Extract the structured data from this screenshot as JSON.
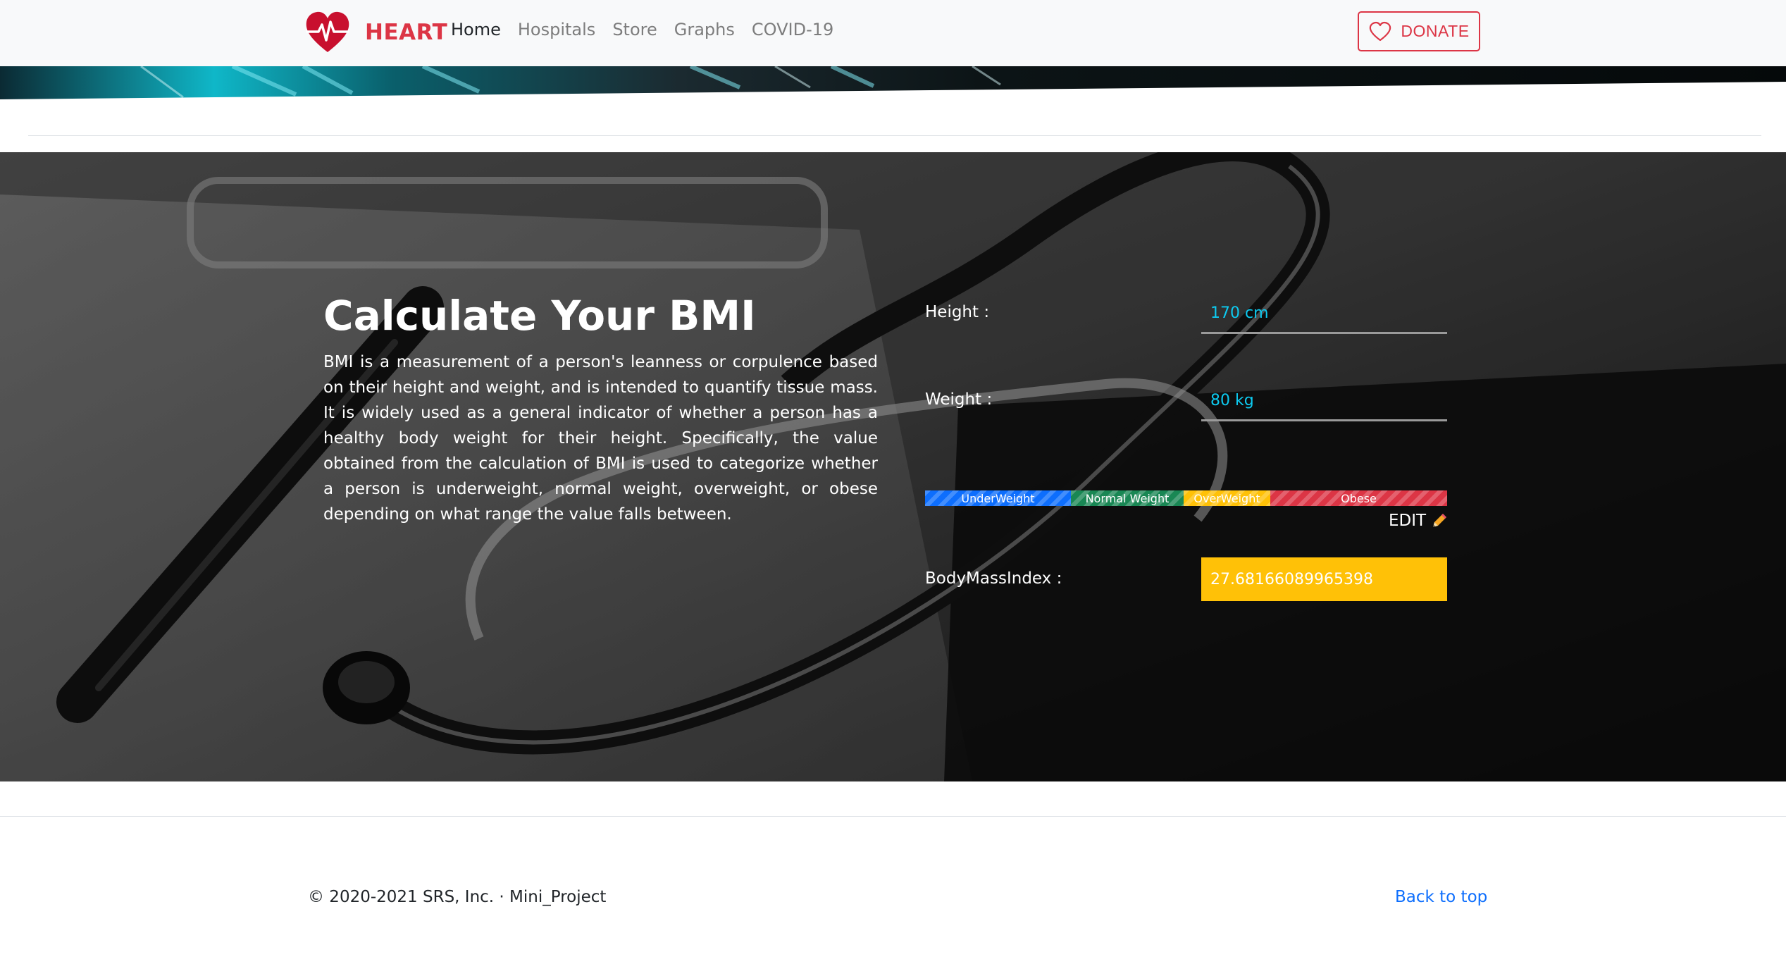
{
  "navbar": {
    "brand": "HEART",
    "brand_icon": "heart-pulse-icon",
    "links": [
      {
        "label": "Home",
        "active": true
      },
      {
        "label": "Hospitals",
        "active": false
      },
      {
        "label": "Store",
        "active": false
      },
      {
        "label": "Graphs",
        "active": false
      },
      {
        "label": "COVID-19",
        "active": false
      }
    ],
    "donate_label": "DONATE",
    "donate_icon": "heart-outline-icon"
  },
  "hero": {
    "title": "Calculate Your BMI",
    "description": "BMI is a measurement of a person's leanness or corpulence based on their height and weight, and is intended to quantify tissue mass. It is widely used as a general indicator of whether a person has a healthy body weight for their height. Specifically, the value obtained from the calculation of BMI is used to categorize whether a person is underweight, normal weight, overweight, or obese depending on what range the value falls between.",
    "height_label": "Height :",
    "height_value": "170 cm",
    "weight_label": "Weight :",
    "weight_value": "80 kg",
    "scale": {
      "underweight": "UnderWeight",
      "normal": "Normal Weight",
      "overweight": "OverWeight",
      "obese": "Obese"
    },
    "edit_label": "EDIT",
    "edit_icon": "pencil-icon",
    "bmi_label": "BodyMassIndex :",
    "bmi_value": "27.68166089965398"
  },
  "footer": {
    "copyright": "© 2020-2021 SRS, Inc. · Mini_Project",
    "back_to_top": "Back to top"
  },
  "colors": {
    "brand_red": "#dc3545",
    "accent_cyan": "#0dcaf0",
    "result_yellow": "#ffc107",
    "link_blue": "#0d6efd",
    "scale_underweight": "#0d6efd",
    "scale_normal": "#198754",
    "scale_overweight": "#ffc107",
    "scale_obese": "#dc3545"
  }
}
